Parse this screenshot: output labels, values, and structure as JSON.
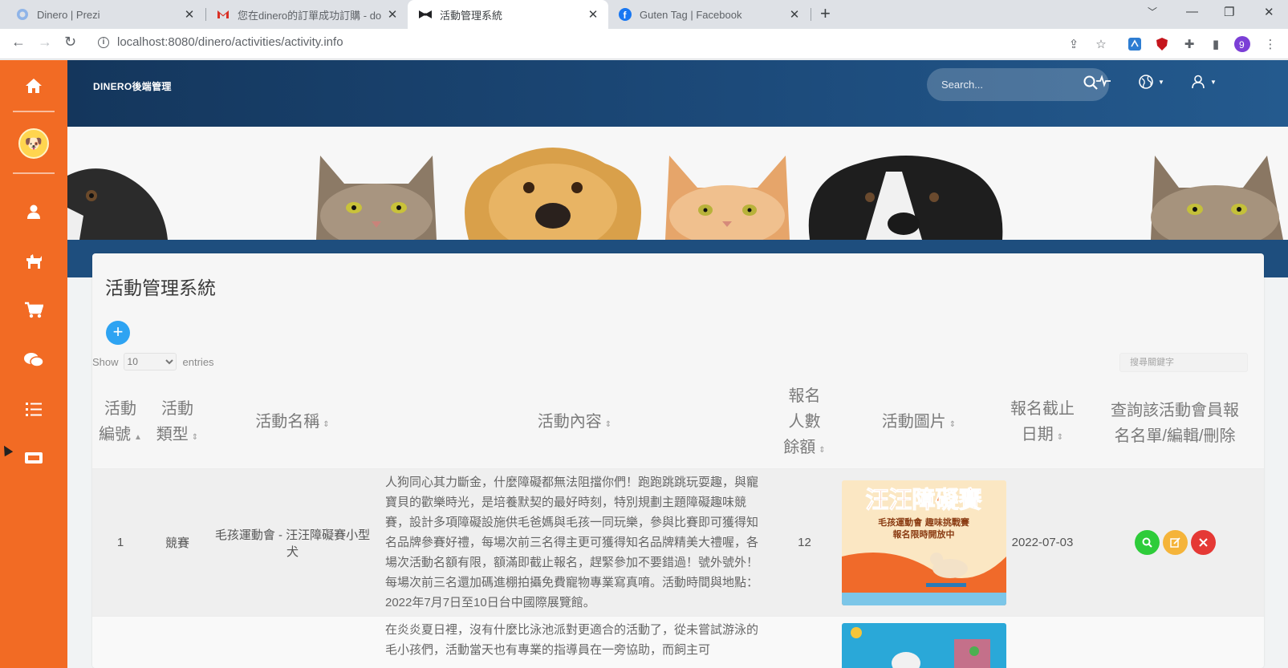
{
  "browser": {
    "tabs": [
      {
        "title": "Dinero | Prezi",
        "favicon": "prezi-icon"
      },
      {
        "title": "您在dinero的訂單成功訂購 - do",
        "favicon": "gmail-icon"
      },
      {
        "title": "活動管理系統",
        "favicon": "bow-icon",
        "active": true
      },
      {
        "title": "Guten Tag | Facebook",
        "favicon": "facebook-icon"
      }
    ],
    "url": "localhost:8080/dinero/activities/activity.info"
  },
  "header": {
    "brand": "DINERO後端管理",
    "search_placeholder": "Search..."
  },
  "sidebar": {
    "items": [
      "home-icon",
      "avatar",
      "user-icon",
      "dog-icon",
      "cart-icon",
      "chat-icon",
      "list-icon",
      "ticket-icon"
    ]
  },
  "page": {
    "title": "活動管理系統",
    "add_label": "+",
    "show_label": "Show",
    "page_size": "10",
    "entries_label": "entries",
    "filter_placeholder": "搜尋關鍵字"
  },
  "table": {
    "headers": [
      {
        "label": "活動\n編號",
        "sort": "▲"
      },
      {
        "label": "活動\n類型",
        "sort": "⇕"
      },
      {
        "label": "活動名稱",
        "sort": "⇕"
      },
      {
        "label": "活動內容",
        "sort": "⇕"
      },
      {
        "label": "報名\n人數\n餘額",
        "sort": "⇕"
      },
      {
        "label": "活動圖片",
        "sort": "⇕"
      },
      {
        "label": "報名截止\n日期",
        "sort": "⇕"
      },
      {
        "label": "查詢該活動會員報\n名名單/編輯/刪除",
        "sort": ""
      }
    ],
    "rows": [
      {
        "id": "1",
        "type": "競賽",
        "name": "毛孩運動會 - 汪汪障礙賽小型犬",
        "content": "人狗同心其力斷金，什麼障礙都無法阻擋你們！跑跑跳跳玩耍趣，與寵寶貝的歡樂時光，是培養默契的最好時刻，特別規劃主題障礙趣味競賽，設計多項障礙設施供毛爸媽與毛孩一同玩樂，參與比賽即可獲得知名品牌參賽好禮，每場次前三名得主更可獲得知名品牌精美大禮喔，各場次活動名額有限，額滿即截止報名，趕緊參加不要錯過！號外號外！每場次前三名還加碼進棚拍攝免費寵物專業寫真唷。活動時間與地點：2022年7月7日至10日台中國際展覽館。",
        "quota": "12",
        "poster_title": "汪汪障礙賽",
        "poster_sub1": "毛孩運動會 趣味挑戰賽",
        "poster_sub2": "報名限時開放中",
        "deadline": "2022-07-03"
      },
      {
        "id": "",
        "type": "",
        "name": "",
        "content": "在炎炎夏日裡，沒有什麼比泳池派對更適合的活動了，從未嘗試游泳的毛小孩們，活動當天也有專業的指導員在一旁協助，而飼主可",
        "quota": "",
        "deadline": ""
      }
    ]
  },
  "colors": {
    "sidebar": "#f26b24",
    "header": "#1c4a7a",
    "add_button": "#2ea3f2",
    "view": "#2ecc3a",
    "edit": "#f5b43a",
    "delete": "#e53935"
  }
}
